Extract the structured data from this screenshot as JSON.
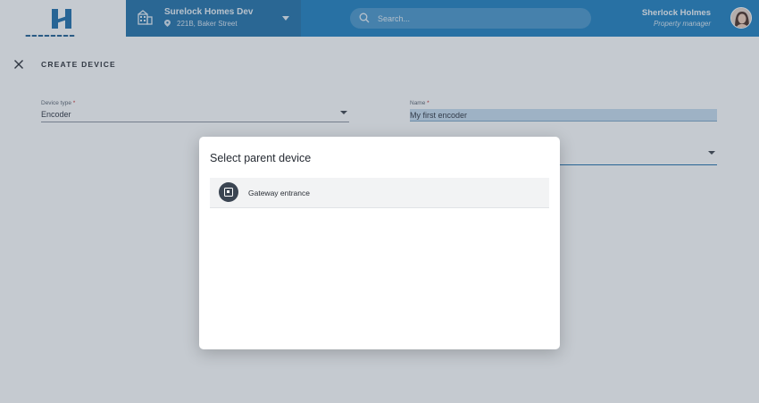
{
  "header": {
    "site_name": "Surelock Homes Dev",
    "site_address": "221B, Baker Street",
    "search_placeholder": "Search...",
    "user_name": "Sherlock Holmes",
    "user_role": "Property manager"
  },
  "page": {
    "title": "CREATE DEVICE",
    "device_type": {
      "label": "Device type",
      "required_mark": "*",
      "value": "Encoder"
    },
    "name": {
      "label": "Name",
      "required_mark": "*",
      "value": "My first encoder"
    }
  },
  "dialog": {
    "title": "Select parent device",
    "items": [
      {
        "label": "Gateway entrance"
      }
    ]
  },
  "colors": {
    "header_blue": "#1f80c0",
    "selector_blue": "#2271aa",
    "required_red": "#c62828"
  }
}
